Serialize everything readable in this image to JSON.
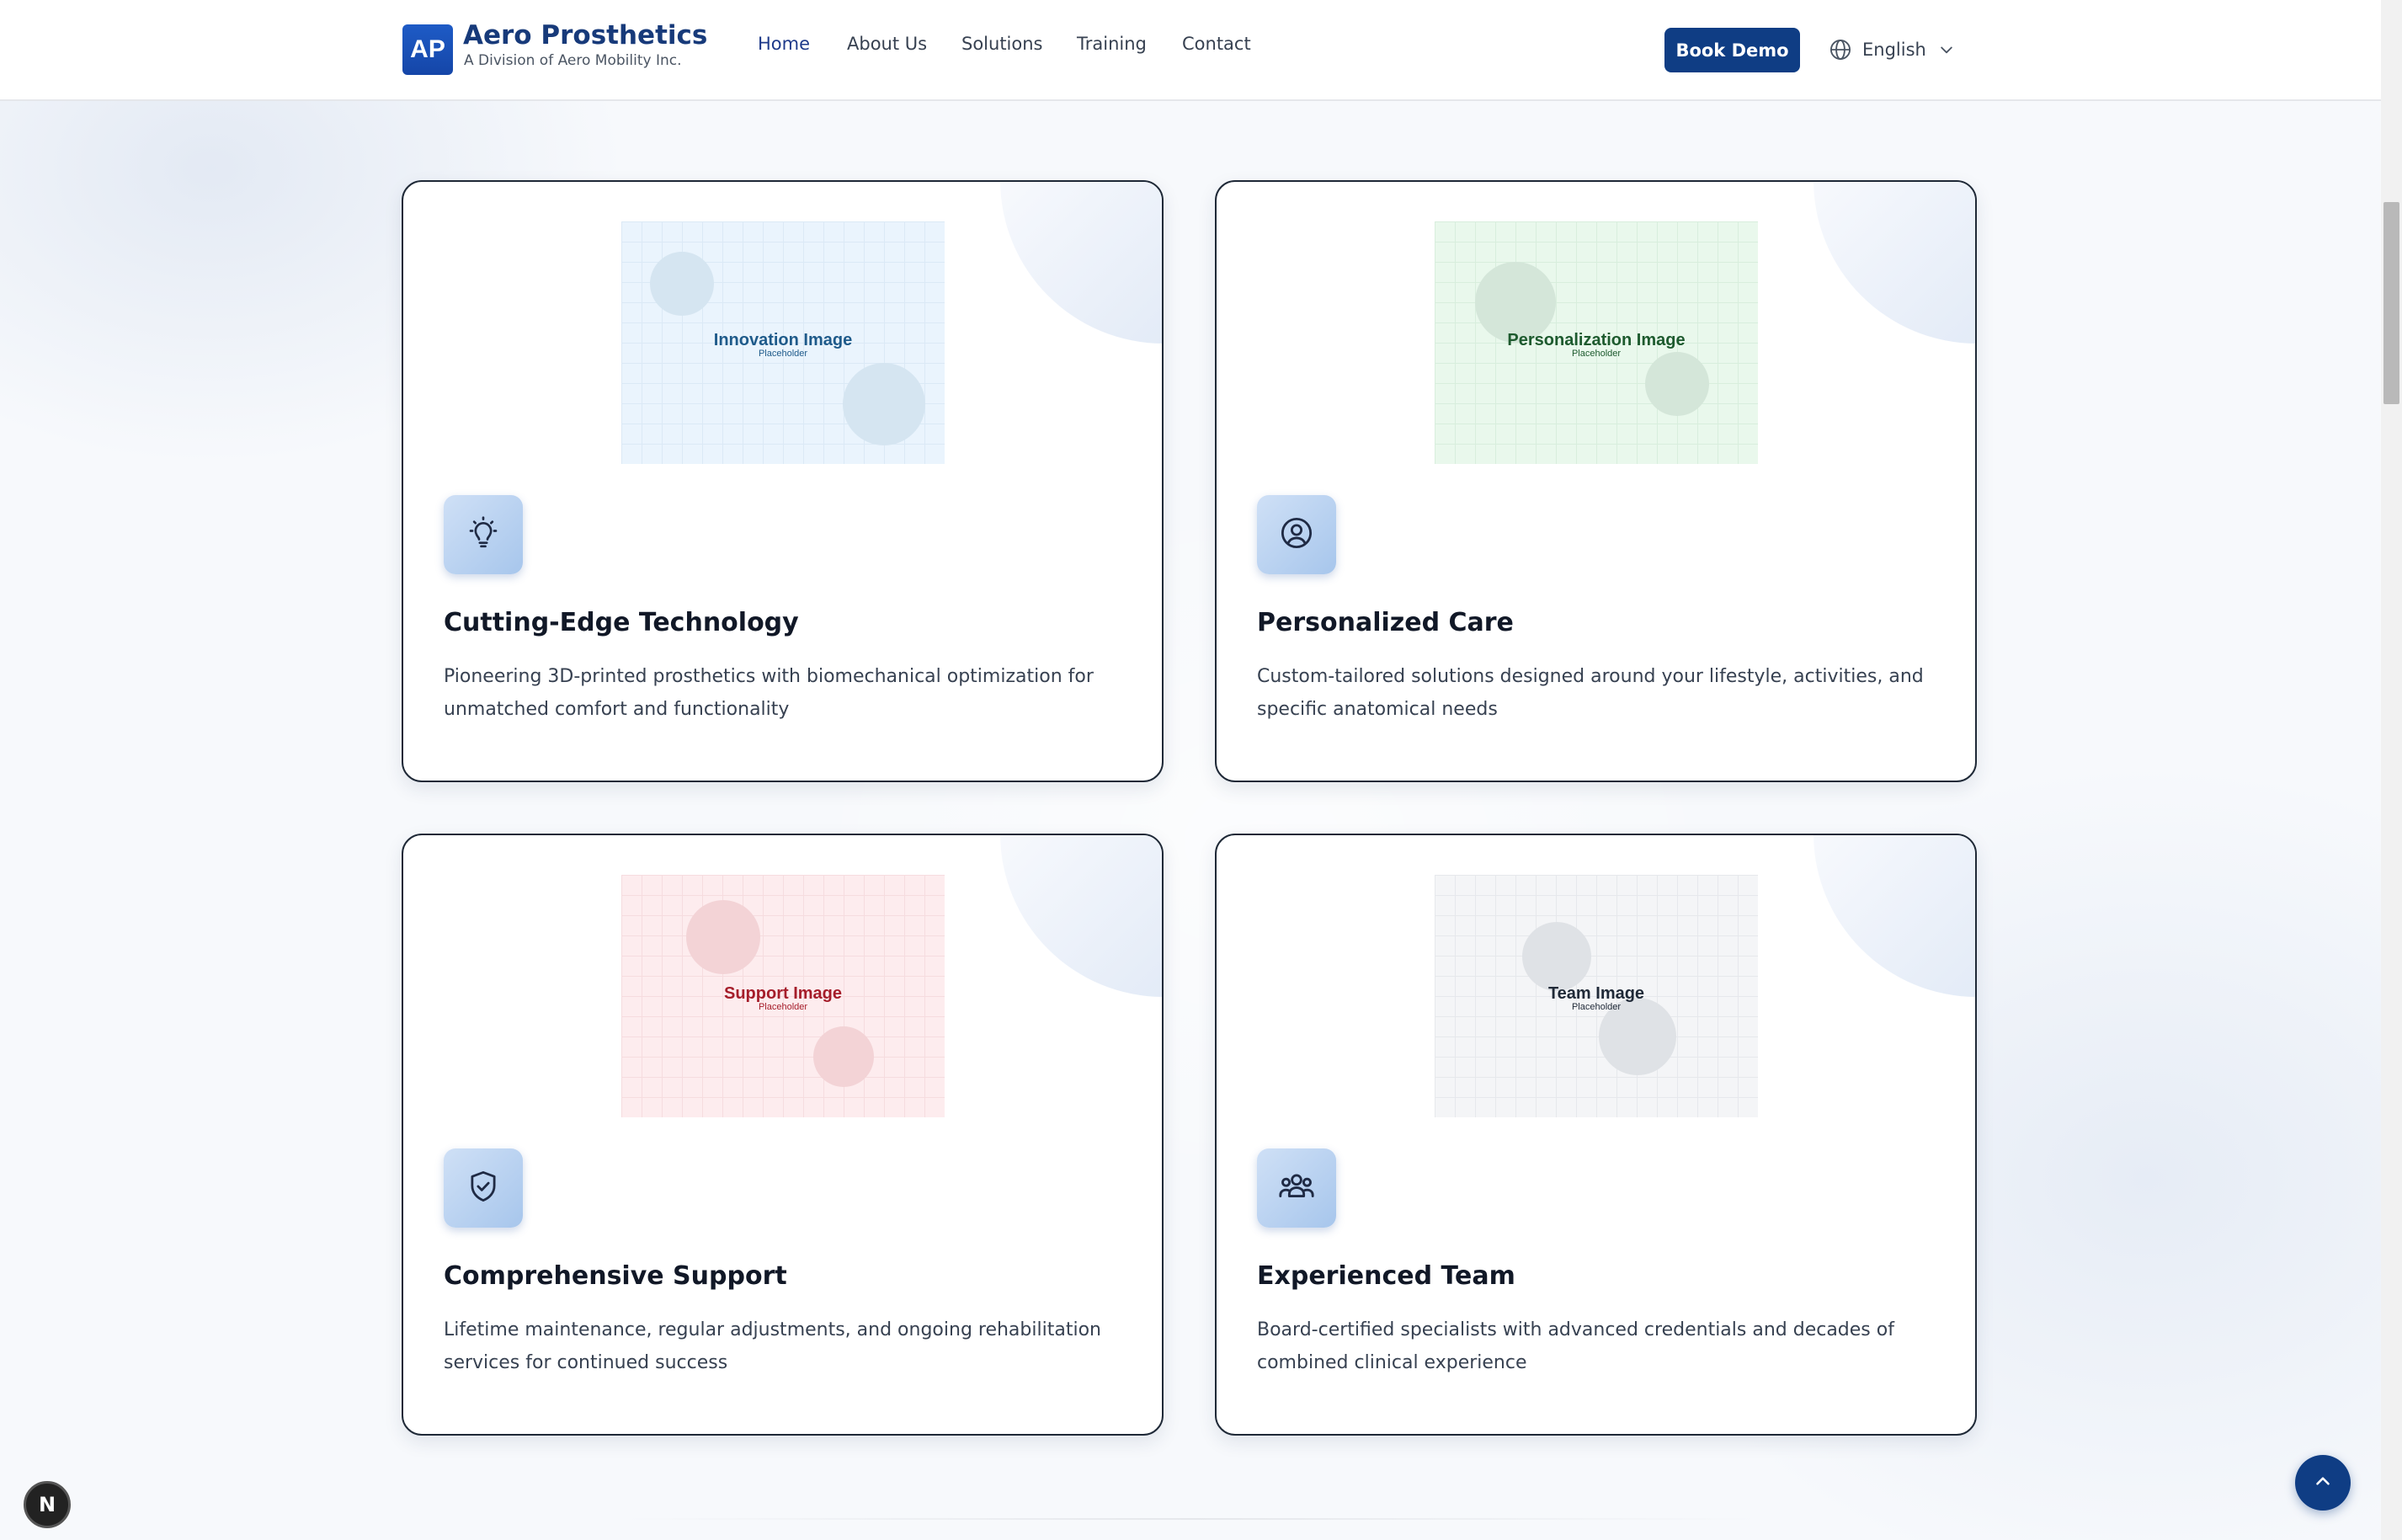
{
  "header": {
    "logo_text": "AP",
    "brand_name": "Aero Prosthetics",
    "brand_subtitle": "A Division of Aero Mobility Inc.",
    "nav": [
      {
        "label": "Home",
        "active": true
      },
      {
        "label": "About Us",
        "active": false
      },
      {
        "label": "Solutions",
        "active": false
      },
      {
        "label": "Training",
        "active": false
      },
      {
        "label": "Contact",
        "active": false
      }
    ],
    "cta_label": "Book Demo",
    "language": "English"
  },
  "cards": [
    {
      "placeholder_title": "Innovation Image",
      "placeholder_sub": "Placeholder",
      "icon": "lightbulb-icon",
      "title": "Cutting-Edge Technology",
      "description": "Pioneering 3D-printed prosthetics with biomechanical optimization for unmatched comfort and functionality"
    },
    {
      "placeholder_title": "Personalization Image",
      "placeholder_sub": "Placeholder",
      "icon": "user-circle-icon",
      "title": "Personalized Care",
      "description": "Custom-tailored solutions designed around your lifestyle, activities, and specific anatomical needs"
    },
    {
      "placeholder_title": "Support Image",
      "placeholder_sub": "Placeholder",
      "icon": "shield-check-icon",
      "title": "Comprehensive Support",
      "description": "Lifetime maintenance, regular adjustments, and ongoing rehabilitation services for continued success"
    },
    {
      "placeholder_title": "Team Image",
      "placeholder_sub": "Placeholder",
      "icon": "team-icon",
      "title": "Experienced Team",
      "description": "Board-certified specialists with advanced credentials and decades of combined clinical experience"
    }
  ],
  "colors": {
    "brand": "#0f3d84",
    "innovation_tint": "#eaf4fd",
    "personalization_tint": "#e9f8ec",
    "support_tint": "#fdecee",
    "team_tint": "#f4f5f7"
  },
  "floating": {
    "scroll_top_icon": "chevron-up-icon",
    "dev_badge_letter": "N"
  }
}
